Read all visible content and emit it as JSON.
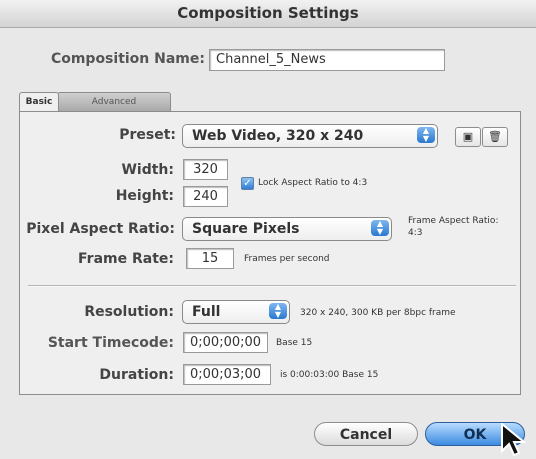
{
  "window": {
    "title": "Composition Settings"
  },
  "composition": {
    "name_label": "Composition Name:",
    "name_value": "Channel_5_News"
  },
  "tabs": [
    {
      "label": "Basic",
      "selected": true
    },
    {
      "label": "Advanced",
      "selected": false
    }
  ],
  "basic": {
    "preset_label": "Preset:",
    "preset_value": "Web Video, 320 x 240",
    "save_icon": "save-icon",
    "delete_icon": "trash-icon",
    "width_label": "Width:",
    "width_value": "320",
    "height_label": "Height:",
    "height_value": "240",
    "lock_aspect_label": "Lock Aspect Ratio to 4:3",
    "lock_aspect_checked": true,
    "pixel_aspect_label": "Pixel Aspect Ratio:",
    "pixel_aspect_value": "Square Pixels",
    "frame_aspect_label": "Frame Aspect Ratio:",
    "frame_aspect_value": "4:3",
    "frame_rate_label": "Frame Rate:",
    "frame_rate_value": "15",
    "frame_rate_unit": "Frames per second",
    "resolution_label": "Resolution:",
    "resolution_value": "Full",
    "resolution_info": "320 x 240, 300 KB per 8bpc frame",
    "start_timecode_label": "Start Timecode:",
    "start_timecode_value": "0;00;00;00",
    "start_timecode_base": "Base 15",
    "duration_label": "Duration:",
    "duration_value": "0;00;03;00",
    "duration_info": "is 0:00:03:00  Base 15"
  },
  "buttons": {
    "cancel": "Cancel",
    "ok": "OK"
  },
  "colors": {
    "accent": "#3c8ae0",
    "window_bg": "#e8e8e8"
  }
}
